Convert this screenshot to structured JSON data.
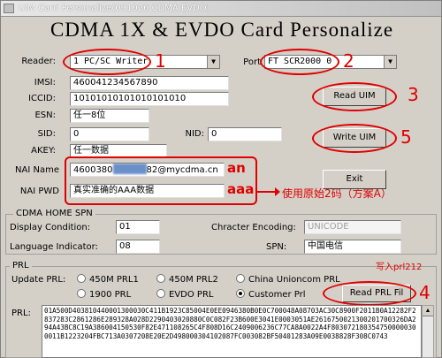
{
  "window": {
    "title": "UIM Card Personalize(091026 CDMA EVDO)"
  },
  "header": {
    "title": "CDMA 1X & EVDO Card Personalize"
  },
  "reader": {
    "label": "Reader:",
    "value": "1 PC/SC Writer",
    "annot": "1"
  },
  "port": {
    "label": "Port",
    "value": "FT SCR2000 0",
    "annot": "2"
  },
  "fields": {
    "imsi": {
      "label": "IMSI:",
      "value": "460041234567890"
    },
    "iccid": {
      "label": "ICCID:",
      "value": "10101010101010101010"
    },
    "esn": {
      "label": "ESN:",
      "value": "任一8位"
    },
    "sid": {
      "label": "SID:",
      "value": "0"
    },
    "nid": {
      "label": "NID:",
      "value": "0"
    },
    "akey": {
      "label": "AKEY:",
      "value": "任一数据"
    },
    "nai_name": {
      "label": "NAI Name",
      "value_prefix": "4600380",
      "value_suffix": "82@mycdma.cn",
      "annot": "an"
    },
    "nai_pwd": {
      "label": "NAI PWD",
      "value": "真实准确的AAA数据",
      "annot": "aaa"
    }
  },
  "buttons": {
    "read_uim": "Read UIM",
    "write_uim": "Write UIM",
    "exit": "Exit",
    "read_prl": "Read PRL Fil"
  },
  "annotations": {
    "read_num": "3",
    "write_num": "5",
    "prl_num": "4",
    "arrow_note": "使用原始2码（方案A）",
    "write_prl_note": "写入prl212"
  },
  "spn": {
    "group_title": "CDMA HOME SPN",
    "display_label": "Display Condition:",
    "display_value": "01",
    "encoding_label": "Chracter Encoding:",
    "encoding_value": "UNICODE",
    "language_label": "Language Indicator:",
    "language_value": "08",
    "spn_label": "SPN:",
    "spn_value": "中国电信"
  },
  "prl": {
    "group_title": "PRL",
    "update_label": "Update PRL:",
    "options": [
      "450M PRL1",
      "450M PRL2",
      "China Unioncom PRL",
      "1900 PRL",
      "EVDO PRL",
      "Customer Prl"
    ],
    "selected": "Customer Prl",
    "prl_label": "PRL:",
    "data": "01A500D403810440001300030C411B1923C85004E0EE0946380B0E0C700048A08703AC30C8900F2011B0A12282F2837283C2861286E289328A028D2290403020880C0C082F23B600E3041E0003051AE2616750021300201700326DA294A43BC8C19A386004150530F82E471108265C4F808D16C2409006236C77CA8A0022A4F8030721803547500000300011B1223204FBC713A0307208E20E2D498000304102087FC003082BF50401283A09E0038828F308C0743"
  }
}
